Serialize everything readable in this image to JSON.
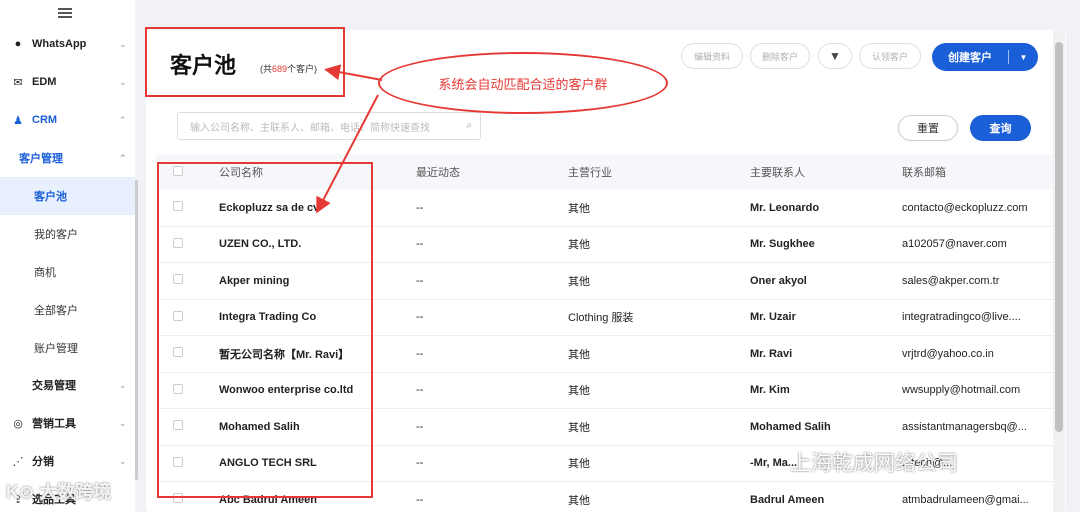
{
  "sidebar": {
    "items": [
      {
        "label": "WhatsApp",
        "icon": "whatsapp-icon"
      },
      {
        "label": "EDM",
        "icon": "mail-icon"
      },
      {
        "label": "CRM",
        "icon": "users-icon"
      }
    ],
    "crm_group": "客户管理",
    "crm_children": [
      "客户池",
      "我的客户",
      "商机",
      "全部客户",
      "账户管理"
    ],
    "more_items": [
      {
        "label": "交易管理",
        "icon": ""
      },
      {
        "label": "营销工具",
        "icon": "target-icon"
      },
      {
        "label": "分销",
        "icon": "share-icon"
      },
      {
        "label": "选品工具",
        "icon": "upload-icon"
      }
    ]
  },
  "header": {
    "title": "客户池",
    "count_prefix": "(共",
    "count": "689",
    "count_suffix": "个客户)"
  },
  "toolbar": {
    "edit_label": "编辑资料",
    "delete_label": "删除客户",
    "claim_label": "认领客户",
    "create_label": "创建客户",
    "filter_icon": "filter-icon"
  },
  "search": {
    "placeholder": "输入公司名称、主联系人、邮箱、电话、简称快速查找",
    "reset_label": "重置",
    "query_label": "查询"
  },
  "table": {
    "columns": [
      "公司名称",
      "最近动态",
      "主营行业",
      "主要联系人",
      "联系邮箱"
    ],
    "rows": [
      [
        "Eckopluzz sa de cv",
        "--",
        "其他",
        "Mr. Leonardo",
        "contacto@eckopluzz.com"
      ],
      [
        "UZEN CO., LTD.",
        "--",
        "其他",
        "Mr. Sugkhee",
        "a102057@naver.com"
      ],
      [
        "Akper mining",
        "--",
        "其他",
        "Oner akyol",
        "sales@akper.com.tr"
      ],
      [
        "Integra Trading Co",
        "--",
        "Clothing 服装",
        "Mr. Uzair",
        "integratradingco@live...."
      ],
      [
        "暂无公司名称【Mr. Ravi】",
        "--",
        "其他",
        "Mr. Ravi",
        "vrjtrd@yahoo.co.in"
      ],
      [
        "Wonwoo enterprise co.ltd",
        "--",
        "其他",
        "Mr. Kim",
        "wwsupply@hotmail.com"
      ],
      [
        "Mohamed Salih",
        "--",
        "其他",
        "Mohamed Salih",
        "assistantmanagersbq@..."
      ],
      [
        "ANGLO TECH SRL",
        "--",
        "其他",
        "-Mr, Ma...",
        "...tech@..."
      ],
      [
        "Abc Badrul Ameen",
        "--",
        "其他",
        "Badrul Ameen",
        "atmbadrulameen@gmai..."
      ]
    ]
  },
  "annotation": {
    "callout": "系统会自动匹配合适的客户群",
    "color": "#e53935"
  },
  "watermarks": {
    "left": "K⊘ 大数跨境",
    "right": "上海乾成网络公司"
  }
}
